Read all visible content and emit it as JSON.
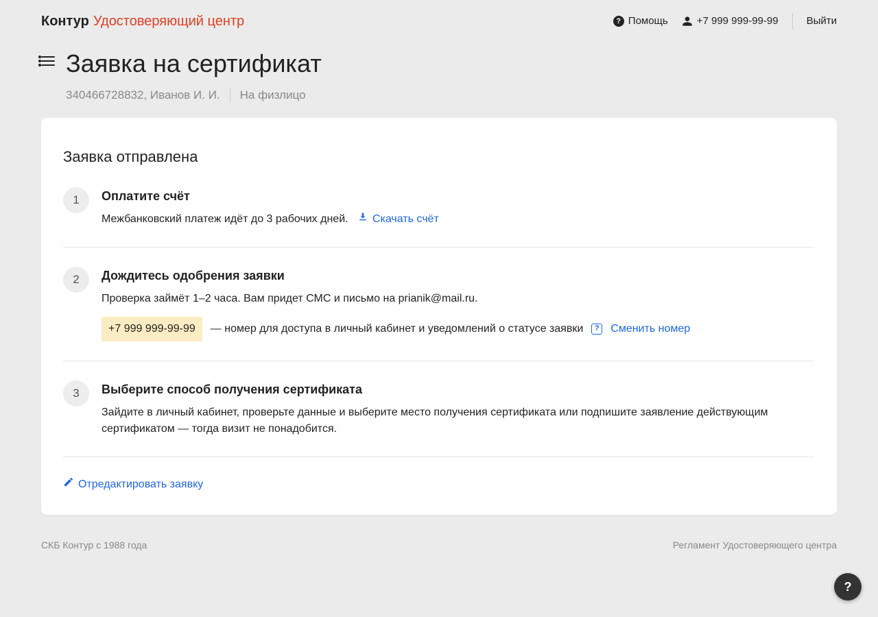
{
  "header": {
    "logo_main": "Контур",
    "logo_sub": "Удостоверяющий центр",
    "help_label": "Помощь",
    "phone": "+7 999 999-99-99",
    "logout_label": "Выйти"
  },
  "page": {
    "title": "Заявка на сертификат",
    "subtitle_id": "340466728832, Иванов И. И.",
    "subtitle_type": "На физлицо"
  },
  "card": {
    "title": "Заявка отправлена",
    "steps": [
      {
        "num": "1",
        "title": "Оплатите счёт",
        "desc": "Межбанковский платеж идёт до 3 рабочих дней.",
        "download_link": "Скачать счёт"
      },
      {
        "num": "2",
        "title": "Дождитесь одобрения заявки",
        "desc_prefix": "Проверка займёт 1–2 часа. Вам придет СМС и письмо на ",
        "email": "prianik@mail.ru",
        "desc_suffix": ".",
        "phone_hl": "+7 999 999-99-99",
        "phone_note": " — номер для доступа в личный кабинет и уведомлений о статусе заявки",
        "change_link": "Сменить номер"
      },
      {
        "num": "3",
        "title": "Выберите способ получения сертификата",
        "desc": "Зайдите в личный кабинет, проверьте данные и выберите место получения сертификата или подпишите заявление действующим сертификатом — тогда визит не понадобится."
      }
    ],
    "edit_link": "Отредактировать заявку"
  },
  "footer": {
    "left": "СКБ Контур с 1988 года",
    "right": "Регламент Удостоверяющего центра"
  },
  "fab": "?"
}
